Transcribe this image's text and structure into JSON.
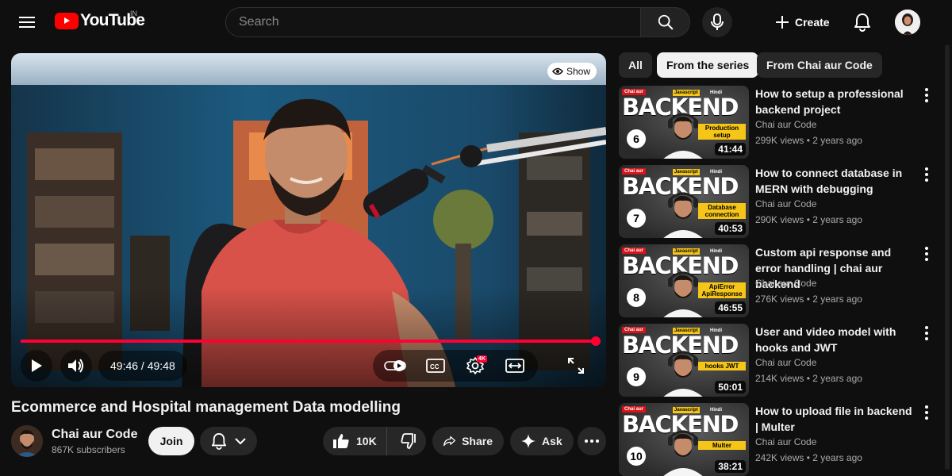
{
  "header": {
    "logo_text": "YouTube",
    "country": "IN",
    "search_placeholder": "Search",
    "create_label": "Create"
  },
  "player": {
    "show_label": "Show",
    "time": "49:46 / 49:48",
    "progress": 0.999,
    "hd_badge": "4K"
  },
  "video": {
    "title": "Ecommerce and Hospital management Data modelling",
    "channel_name": "Chai aur Code",
    "subscribers": "867K subscribers",
    "join_label": "Join",
    "likes": "10K",
    "share_label": "Share",
    "ask_label": "Ask"
  },
  "chips": [
    {
      "label": "All"
    },
    {
      "label": "From the series"
    },
    {
      "label": "From Chai aur Code"
    }
  ],
  "recommendations": [
    {
      "title": "How to setup a professional backend project",
      "channel": "Chai aur Code",
      "meta": "299K views • 2 years ago",
      "duration": "41:44",
      "episode": "6",
      "label": "Production setup",
      "thumb_big": "BACKEND",
      "tag1": "Chai aur",
      "tag2": "Javascript",
      "tag3": "Hindi"
    },
    {
      "title": "How to connect database in MERN with debugging",
      "channel": "Chai aur Code",
      "meta": "290K views • 2 years ago",
      "duration": "40:53",
      "episode": "7",
      "label": "Database connection",
      "thumb_big": "BACKEND",
      "tag1": "Chai aur",
      "tag2": "Javascript",
      "tag3": "Hindi"
    },
    {
      "title": "Custom api response and error handling | chai aur backend",
      "channel": "Chai aur Code",
      "meta": "276K views • 2 years ago",
      "duration": "46:55",
      "episode": "8",
      "label": "ApiError ApiResponse",
      "thumb_big": "BACKEND",
      "tag1": "Chai aur",
      "tag2": "Javascript",
      "tag3": "Hindi"
    },
    {
      "title": "User and video model with hooks and JWT",
      "channel": "Chai aur Code",
      "meta": "214K views • 2 years ago",
      "duration": "50:01",
      "episode": "9",
      "label": "hooks JWT",
      "thumb_big": "BACKEND",
      "tag1": "Chai aur",
      "tag2": "Javascript",
      "tag3": "Hindi"
    },
    {
      "title": "How to upload file in backend | Multer",
      "channel": "Chai aur Code",
      "meta": "242K views • 2 years ago",
      "duration": "38:21",
      "episode": "10",
      "label": "Multer",
      "thumb_big": "BACKEND",
      "tag1": "Chai aur",
      "tag2": "Javascript",
      "tag3": "Hindi"
    }
  ],
  "colors": {
    "background": "#0f0f0f",
    "accent": "#ff0033",
    "chip_active": "#f1f1f1",
    "thumb_label": "#f5c518"
  },
  "icons": {
    "menu": "menu-icon",
    "search": "search-icon",
    "mic": "mic-icon",
    "create": "plus-icon",
    "notifications": "bell-icon",
    "play": "play-icon",
    "volume": "volume-icon",
    "autoplay": "autoplay-toggle-icon",
    "captions": "captions-icon",
    "settings": "gear-icon",
    "theater": "theater-icon",
    "fullscreen": "fullscreen-icon",
    "like": "thumbs-up-icon",
    "dislike": "thumbs-down-icon",
    "share": "share-icon",
    "ask": "sparkle-icon",
    "more": "more-horizontal-icon"
  }
}
